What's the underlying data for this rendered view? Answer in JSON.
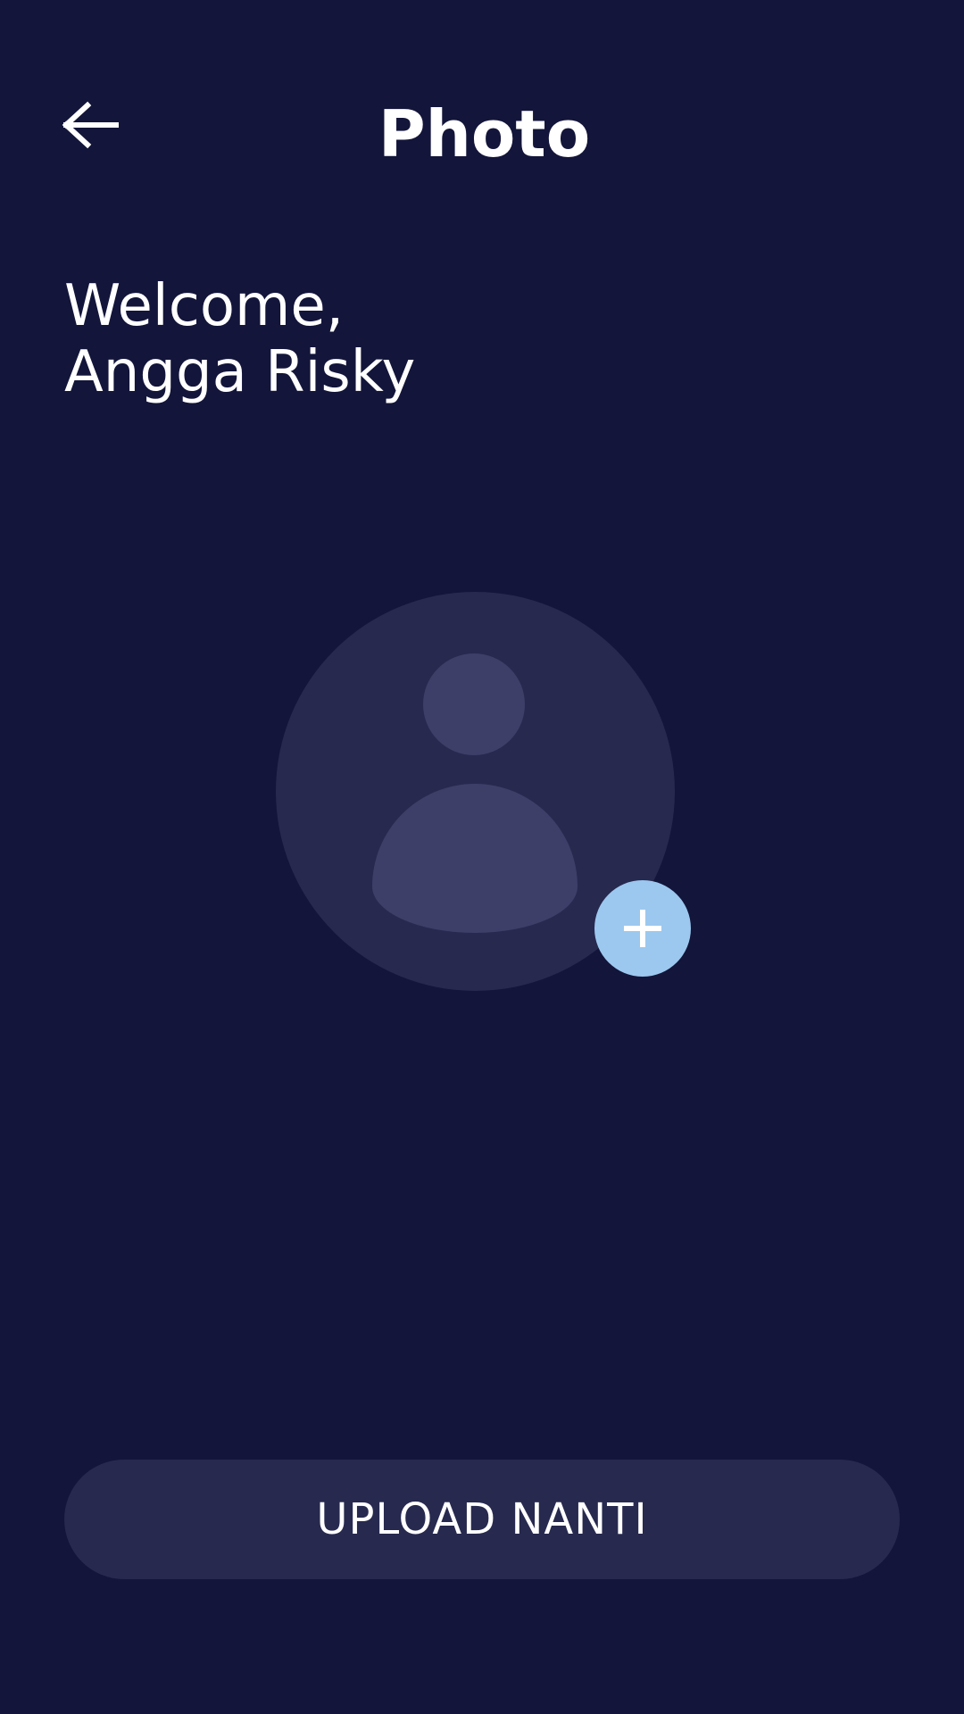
{
  "header": {
    "title": "Photo",
    "back_icon": "arrow-left-icon"
  },
  "welcome": {
    "line1": "Welcome,",
    "line2": "Angga Risky"
  },
  "avatar": {
    "placeholder_icon": "user-placeholder-icon",
    "add_icon": "plus-icon"
  },
  "actions": {
    "upload_later_label": "UPLOAD NANTI"
  },
  "colors": {
    "background": "#13153a",
    "surface": "#27294f",
    "avatar_figure": "#3d3f69",
    "accent": "#9cc8ef",
    "text": "#ffffff"
  }
}
